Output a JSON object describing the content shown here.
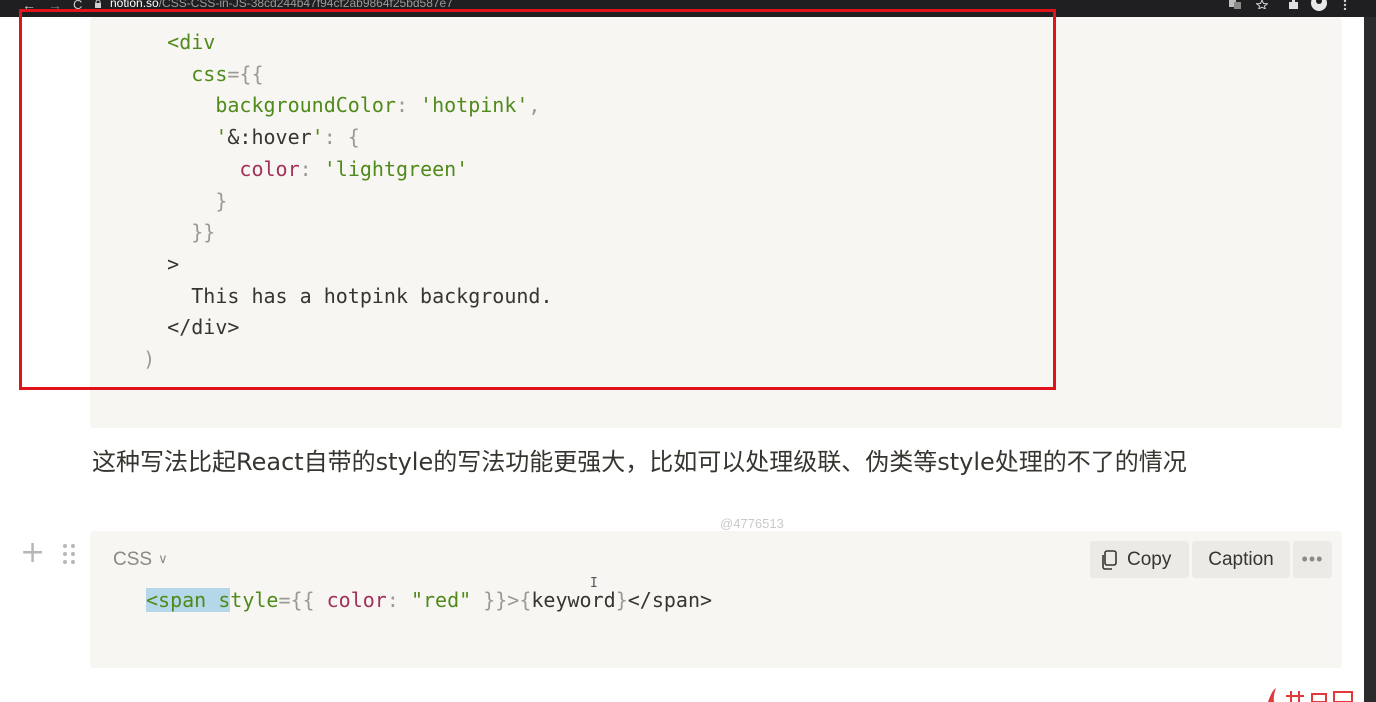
{
  "browser": {
    "back_glyph": "←",
    "forward_glyph": "→",
    "reload_glyph": "C",
    "url_host": "notion.so",
    "url_path": "/CSS-CSS-in-JS-38cd244b47f94cf2ab9864f25bd587e7",
    "right_icons": [
      "translate-icon",
      "star-icon",
      "extensions-icon",
      "profile-icon",
      "menu-icon"
    ]
  },
  "code_block_1": {
    "lines": [
      {
        "indent": "    ",
        "tokens": [
          [
            "tag",
            "<div"
          ]
        ]
      },
      {
        "indent": "      ",
        "tokens": [
          [
            "tag",
            "css"
          ],
          [
            "punct",
            "={{"
          ]
        ]
      },
      {
        "indent": "        ",
        "tokens": [
          [
            "tag",
            "backgroundColor"
          ],
          [
            "punct",
            ": "
          ],
          [
            "str",
            "'hotpink'"
          ],
          [
            "punct",
            ","
          ]
        ]
      },
      {
        "indent": "        ",
        "tokens": [
          [
            "str",
            "'"
          ],
          [
            "plain",
            "&:hover"
          ],
          [
            "str",
            "'"
          ],
          [
            "punct",
            ": {"
          ]
        ]
      },
      {
        "indent": "          ",
        "tokens": [
          [
            "key",
            "color"
          ],
          [
            "punct",
            ": "
          ],
          [
            "str",
            "'lightgreen'"
          ]
        ]
      },
      {
        "indent": "        ",
        "tokens": [
          [
            "punct",
            "}"
          ]
        ]
      },
      {
        "indent": "      ",
        "tokens": [
          [
            "punct",
            "}}"
          ]
        ]
      },
      {
        "indent": "    ",
        "tokens": [
          [
            "plain",
            ">"
          ]
        ]
      },
      {
        "indent": "      ",
        "tokens": [
          [
            "plain",
            "This has a hotpink background."
          ]
        ]
      },
      {
        "indent": "    ",
        "tokens": [
          [
            "plain",
            "</div>"
          ]
        ]
      },
      {
        "indent": "  ",
        "tokens": [
          [
            "punct",
            ")"
          ]
        ]
      }
    ]
  },
  "paragraph": {
    "text": "这种写法比起React自带的style的写法功能更强大，比如可以处理级联、伪类等style处理的不了的情况"
  },
  "watermark": "@4776513",
  "code_block_2": {
    "language": "CSS",
    "copy_label": "Copy",
    "caption_label": "Caption",
    "more_label": "•••",
    "line": {
      "selected": "<span s",
      "tokens": [
        [
          "plain",
          "tyle"
        ],
        [
          "punct",
          "={{ "
        ],
        [
          "key",
          "color"
        ],
        [
          "punct",
          ": "
        ],
        [
          "str",
          "\"red\""
        ],
        [
          "punct",
          " }}>"
        ],
        [
          "punct",
          "{"
        ],
        [
          "plain",
          "keyword"
        ],
        [
          "punct",
          "}"
        ],
        [
          "plain",
          "</span>"
        ]
      ]
    }
  },
  "cursor_glyph": "I",
  "colors": {
    "code_bg": "#f7f6f3",
    "highlight_border": "#e0121a",
    "text": "#37352f",
    "tag_green": "#508a1a",
    "key_red": "#a2305a",
    "punct_gray": "#9b9a97",
    "selection": "#b4d7e9",
    "brand_red": "#e23a3a"
  }
}
